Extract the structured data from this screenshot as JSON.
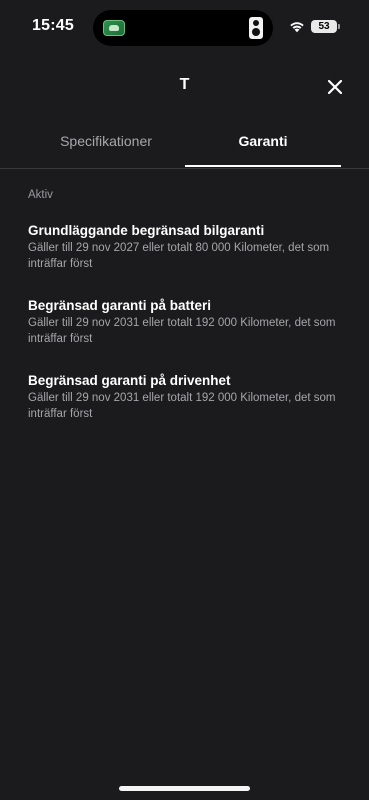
{
  "status_bar": {
    "time": "15:45",
    "battery": "53",
    "icons": [
      "car-app-icon",
      "speaker-icon",
      "wifi-icon",
      "battery-icon"
    ]
  },
  "header": {
    "title": "T",
    "close_icon": "close-icon"
  },
  "tabs": [
    {
      "label": "Specifikationer",
      "active": false
    },
    {
      "label": "Garanti",
      "active": true
    }
  ],
  "section": {
    "label": "Aktiv"
  },
  "warranties": [
    {
      "title": "Grundläggande begränsad bilgaranti",
      "description": "Gäller till 29 nov 2027 eller totalt 80 000 Kilometer, det som inträffar först"
    },
    {
      "title": "Begränsad garanti på batteri",
      "description": "Gäller till 29 nov 2031 eller totalt 192 000 Kilometer, det som inträffar först"
    },
    {
      "title": "Begränsad garanti på drivenhet",
      "description": "Gäller till 29 nov 2031 eller totalt 192 000 Kilometer, det som inträffar först"
    }
  ],
  "colors": {
    "background": "#1b1b1d",
    "text_primary": "#ffffff",
    "text_secondary": "#a6a6aa",
    "divider": "#3a3a3c"
  }
}
